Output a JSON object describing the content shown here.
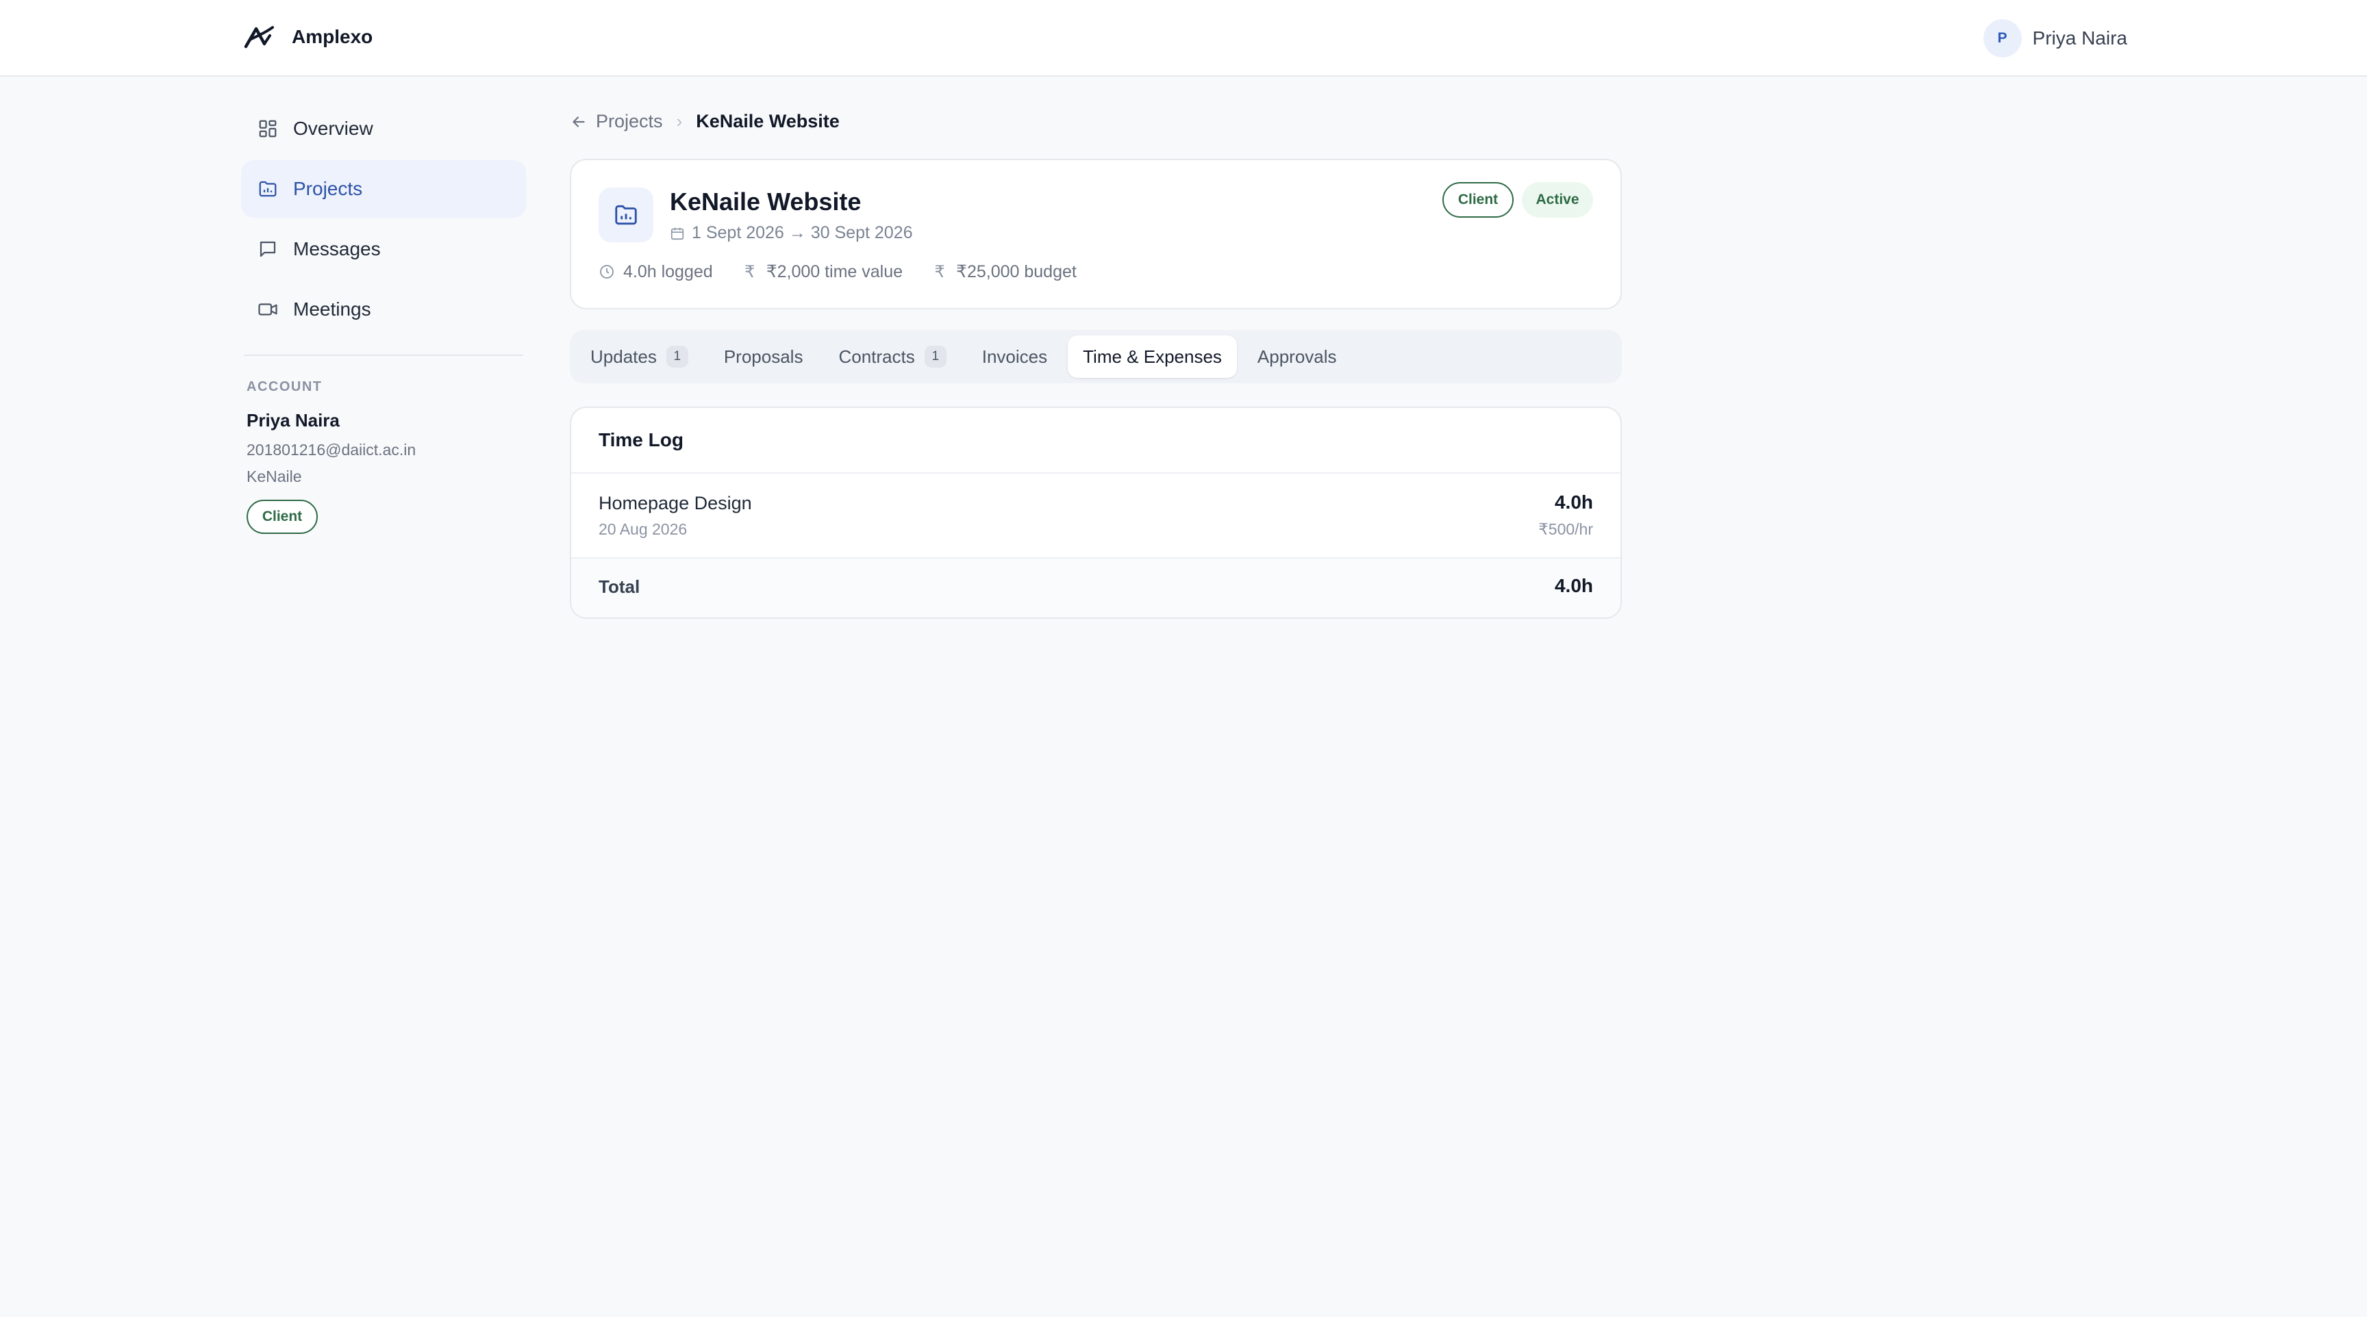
{
  "app": {
    "name": "Amplexo"
  },
  "header": {
    "user_initial": "P",
    "user_name": "Priya Naira"
  },
  "sidebar": {
    "items": [
      {
        "label": "Overview",
        "icon": "grid-icon"
      },
      {
        "label": "Projects",
        "icon": "folder-icon",
        "active": true
      },
      {
        "label": "Messages",
        "icon": "message-icon"
      },
      {
        "label": "Meetings",
        "icon": "video-icon"
      }
    ],
    "account": {
      "heading": "ACCOUNT",
      "name": "Priya Naira",
      "email": "201801216@daiict.ac.in",
      "org": "KeNaile",
      "role": "Client"
    }
  },
  "breadcrumb": {
    "parent": "Projects",
    "current": "KeNaile Website"
  },
  "project": {
    "title": "KeNaile Website",
    "dates": "1 Sept 2026 → 30 Sept 2026",
    "badge_role": "Client",
    "badge_status": "Active",
    "stats": {
      "logged": "4.0h logged",
      "time_value": "₹2,000 time value",
      "budget": "₹25,000 budget"
    }
  },
  "tabs": [
    {
      "label": "Updates",
      "count": "1"
    },
    {
      "label": "Proposals"
    },
    {
      "label": "Contracts",
      "count": "1"
    },
    {
      "label": "Invoices"
    },
    {
      "label": "Time & Expenses",
      "active": true
    },
    {
      "label": "Approvals"
    }
  ],
  "time_log": {
    "title": "Time Log",
    "entries": [
      {
        "task": "Homepage Design",
        "date": "20 Aug 2026",
        "hours": "4.0h",
        "rate": "₹500/hr"
      }
    ],
    "total_label": "Total",
    "total_value": "4.0h"
  },
  "colors": {
    "accent": "#2d52a8",
    "success": "#2e6a45",
    "background": "#f8f9fb"
  }
}
